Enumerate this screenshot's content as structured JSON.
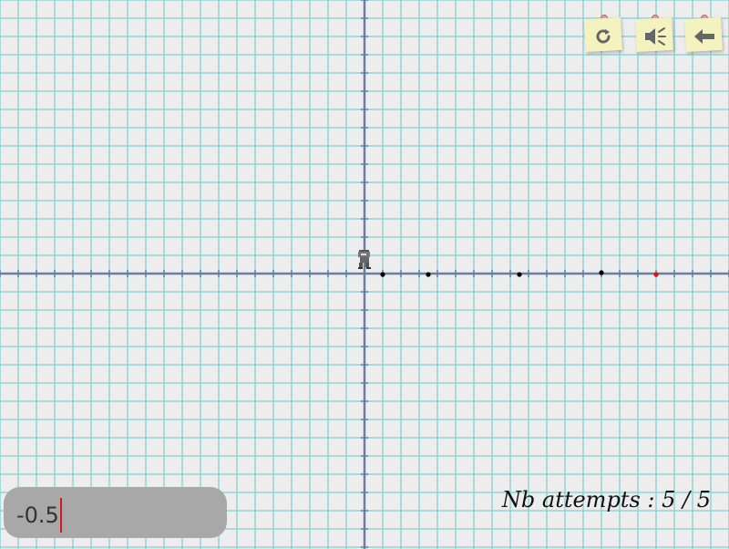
{
  "board": {
    "grid_color": "#8fd4d6",
    "axis_color": "#6a7fa0",
    "background": "#ededed",
    "axis_tick_spacing_units": 1,
    "number_line": {
      "dots": [
        {
          "x": 1,
          "color": "#000000"
        },
        {
          "x": 3.5,
          "color": "#000000"
        },
        {
          "x": 8.5,
          "color": "#000000"
        },
        {
          "x": 13,
          "color": "#000000"
        },
        {
          "x": 16,
          "color": "#e01010"
        }
      ],
      "character_position": 0
    }
  },
  "toolbar": {
    "reload_icon": "reload-icon",
    "sound_icon": "speaker-icon",
    "back_icon": "back-arrow-icon"
  },
  "input": {
    "value": "-0.5"
  },
  "status": {
    "attempts_label": "Nb attempts : 5 / 5"
  }
}
